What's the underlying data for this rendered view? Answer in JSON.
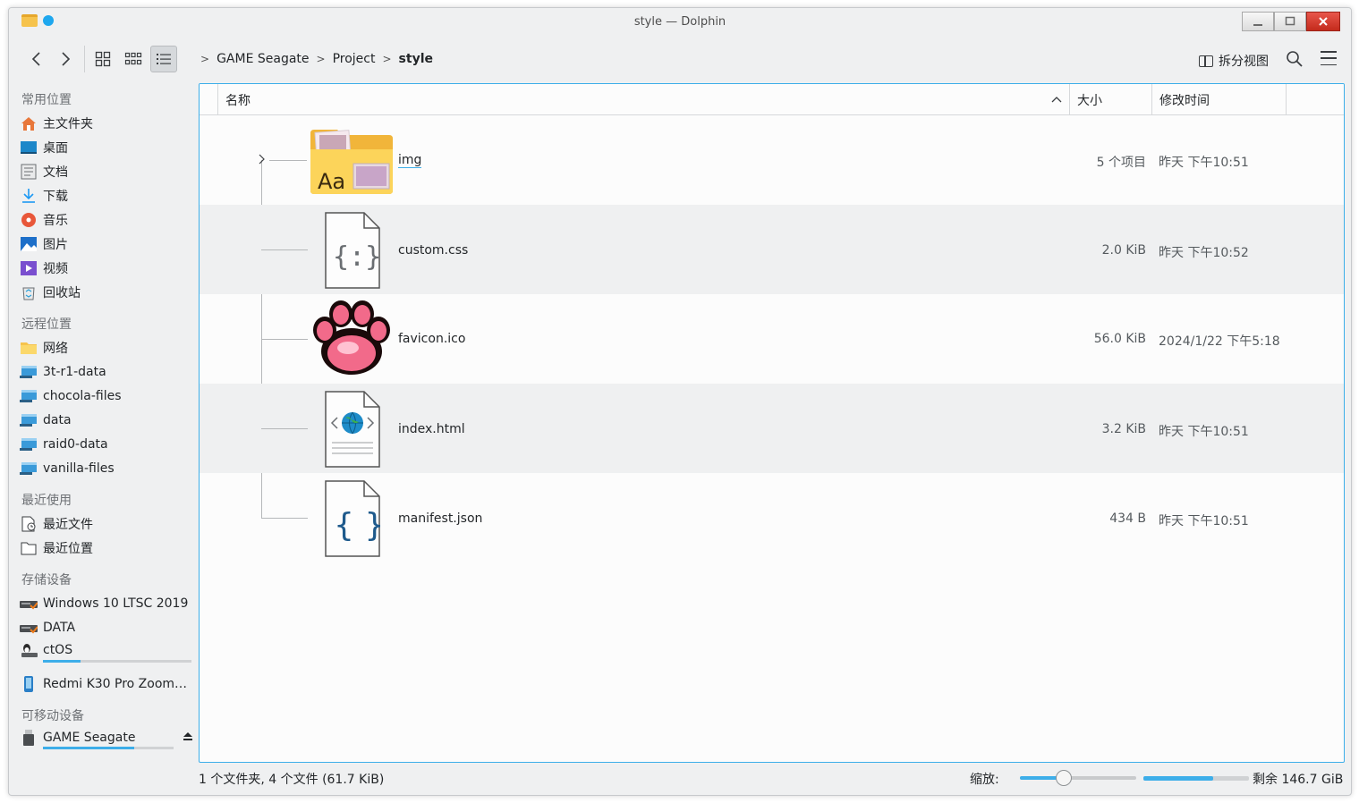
{
  "window": {
    "title": "style — Dolphin"
  },
  "breadcrumb": [
    "GAME Seagate",
    "Project",
    "style"
  ],
  "toolbar": {
    "split_label": "拆分视图"
  },
  "sidebar": {
    "places_title": "常用位置",
    "places": [
      {
        "label": "主文件夹",
        "icon": "home-icon"
      },
      {
        "label": "桌面",
        "icon": "desktop-icon"
      },
      {
        "label": "文档",
        "icon": "documents-icon"
      },
      {
        "label": "下载",
        "icon": "download-icon"
      },
      {
        "label": "音乐",
        "icon": "music-icon"
      },
      {
        "label": "图片",
        "icon": "pictures-icon"
      },
      {
        "label": "视频",
        "icon": "videos-icon"
      },
      {
        "label": "回收站",
        "icon": "trash-icon"
      }
    ],
    "remote_title": "远程位置",
    "remote": [
      {
        "label": "网络",
        "icon": "network-folder-icon"
      },
      {
        "label": "3t-r1-data",
        "icon": "network-drive-icon"
      },
      {
        "label": "chocola-files",
        "icon": "network-drive-icon"
      },
      {
        "label": "data",
        "icon": "network-drive-icon"
      },
      {
        "label": "raid0-data",
        "icon": "network-drive-icon"
      },
      {
        "label": "vanilla-files",
        "icon": "network-drive-icon"
      }
    ],
    "recent_title": "最近使用",
    "recent": [
      {
        "label": "最近文件",
        "icon": "recent-files-icon"
      },
      {
        "label": "最近位置",
        "icon": "recent-locations-icon"
      }
    ],
    "devices_title": "存储设备",
    "devices": [
      {
        "label": "Windows 10 LTSC 2019",
        "icon": "hard-drive-icon",
        "usage": null
      },
      {
        "label": "DATA",
        "icon": "hard-drive-icon",
        "usage": null
      },
      {
        "label": "ctOS",
        "icon": "linux-drive-icon",
        "usage": 0.25
      },
      {
        "label": "Redmi K30 Pro Zoom…",
        "icon": "phone-icon",
        "usage": null
      }
    ],
    "removable_title": "可移动设备",
    "removable": [
      {
        "label": "GAME Seagate",
        "icon": "usb-drive-icon",
        "usage": 0.7
      }
    ]
  },
  "columns": {
    "name": "名称",
    "size": "大小",
    "modified": "修改时间"
  },
  "files": [
    {
      "name": "img",
      "size": "5 个项目",
      "modified": "昨天 下午10:51",
      "icon": "image-folder-icon"
    },
    {
      "name": "custom.css",
      "size": "2.0 KiB",
      "modified": "昨天 下午10:52",
      "icon": "css-file-icon"
    },
    {
      "name": "favicon.ico",
      "size": "56.0 KiB",
      "modified": "2024/1/22 下午5:18",
      "icon": "paw-icon"
    },
    {
      "name": "index.html",
      "size": "3.2 KiB",
      "modified": "昨天 下午10:51",
      "icon": "html-file-icon"
    },
    {
      "name": "manifest.json",
      "size": "434 B",
      "modified": "昨天 下午10:51",
      "icon": "json-file-icon"
    }
  ],
  "status": {
    "summary": "1 个文件夹, 4 个文件 (61.7 KiB)",
    "zoom_label": "缩放:",
    "zoom_level": 0.38,
    "free_space": "剩余 146.7 GiB",
    "free_fraction": 0.66
  },
  "colors": {
    "accent": "#3daee9",
    "alt_row": "#eff0f1",
    "folder": "#f6c34d",
    "close": "#c42b1c"
  }
}
